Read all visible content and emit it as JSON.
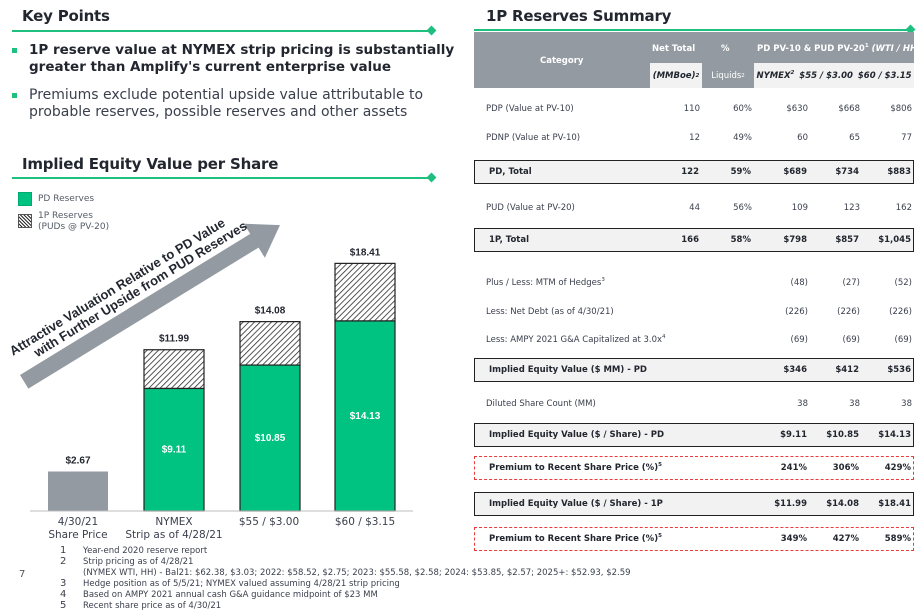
{
  "key_points": {
    "title": "Key Points",
    "bullets": [
      {
        "line1": "1P reserve value at NYMEX strip pricing is substantially",
        "line2": "greater than Amplify's current enterprise value",
        "bold": true
      },
      {
        "line1": "Premiums exclude potential upside value attributable to",
        "line2": "probable reserves, possible reserves and other assets",
        "bold": false
      }
    ]
  },
  "colors": {
    "accent_green": "#1fc07f",
    "pd_green": "#00c281",
    "gray_bar": "#939aa1",
    "header_gray": "#939aa1",
    "dashed_red": "#ee3a3a"
  },
  "chart_title": "Implied Equity Value per Share",
  "arrow_text": {
    "line1": "Attractive Valuation Relative to PD Value",
    "line2": "with Further Upside from PUD Reserves"
  },
  "chart_data": {
    "type": "bar",
    "title": "Implied Equity Value per Share",
    "categories": [
      {
        "line1": "4/30/21",
        "line2": "Share Price"
      },
      {
        "line1": "NYMEX",
        "line2": "Strip as of 4/28/21"
      },
      {
        "line1": "$55 / $3.00",
        "line2": ""
      },
      {
        "line1": "$60 / $3.15",
        "line2": ""
      }
    ],
    "legend": [
      {
        "name": "PD Reserves",
        "style": "solid-green"
      },
      {
        "name": "1P Reserves",
        "sub": "(PUDs @ PV-20)",
        "style": "hatched"
      }
    ],
    "share_price": {
      "value": 2.67,
      "label": "$2.67"
    },
    "series": [
      {
        "name": "PD Reserves",
        "values": [
          null,
          9.11,
          10.85,
          14.13
        ],
        "labels": [
          "",
          "$9.11",
          "$10.85",
          "$14.13"
        ]
      },
      {
        "name": "1P Reserves",
        "values": [
          null,
          11.99,
          14.08,
          18.41
        ],
        "labels": [
          "",
          "$11.99",
          "$14.08",
          "$18.41"
        ]
      }
    ],
    "ylim": [
      0,
      20
    ],
    "xlabel": "",
    "ylabel": "",
    "grid": false
  },
  "footnotes": {
    "page": "7",
    "items": [
      {
        "num": "1",
        "text": "Year-end 2020 reserve report"
      },
      {
        "num": "2",
        "text": "Strip pricing as of 4/28/21"
      },
      {
        "num": "",
        "text": "(NYMEX WTI, HH) - Bal21: $62.38, $3.03; 2022: $58.52, $2.75; 2023: $55.58, $2.58; 2024: $53.85, $2.57; 2025+: $52.93, $2.59"
      },
      {
        "num": "3",
        "text": "Hedge position as of 5/5/21; NYMEX valued assuming 4/28/21 strip pricing"
      },
      {
        "num": "4",
        "text": "Based on AMPY 2021 annual cash G&A guidance midpoint of $23 MM"
      },
      {
        "num": "5",
        "text": "Recent share price as of 4/30/21"
      }
    ]
  },
  "reserves": {
    "title": "1P Reserves Summary",
    "header": {
      "category": "Category",
      "net_total": "Net Total",
      "net_total_unit": "(MMBoe)",
      "net_total_sup": "2",
      "pct": "%",
      "pct_unit": "Liquids",
      "pct_sup": "2",
      "pv_group": "PD PV-10 & PUD PV-20",
      "pv_group_sup": "1",
      "pv_group_italic": " (WTI / HH)",
      "col_nymex": "NYMEX",
      "col_nymex_sup": "2",
      "col_55": "$55 / $3.00",
      "col_60": "$60 / $3.15"
    },
    "rows": [
      {
        "label": "PDP (Value at PV-10)",
        "sup": "",
        "cells": [
          "110",
          "60%",
          "$630",
          "$668",
          "$806"
        ],
        "style": "plain"
      },
      {
        "label": "PDNP (Value at PV-10)",
        "sup": "",
        "cells": [
          "12",
          "49%",
          "60",
          "65",
          "77"
        ],
        "style": "plain"
      },
      {
        "label": "PD, Total",
        "sup": "",
        "cells": [
          "122",
          "59%",
          "$689",
          "$734",
          "$883"
        ],
        "style": "boxed"
      },
      {
        "label": "PUD (Value at PV-20)",
        "sup": "",
        "cells": [
          "44",
          "56%",
          "109",
          "123",
          "162"
        ],
        "style": "plain"
      },
      {
        "label": "1P, Total",
        "sup": "",
        "cells": [
          "166",
          "58%",
          "$798",
          "$857",
          "$1,045"
        ],
        "style": "boxed"
      },
      {
        "label": "Plus / Less: MTM of Hedges",
        "sup": "3",
        "cells": [
          "",
          "",
          "(48)",
          "(27)",
          "(52)"
        ],
        "style": "plain"
      },
      {
        "label": "Less: Net Debt (as of 4/30/21)",
        "sup": "",
        "cells": [
          "",
          "",
          "(226)",
          "(226)",
          "(226)"
        ],
        "style": "plain"
      },
      {
        "label": "Less: AMPY 2021 G&A Capitalized at 3.0x",
        "sup": "4",
        "cells": [
          "",
          "",
          "(69)",
          "(69)",
          "(69)"
        ],
        "style": "plain"
      },
      {
        "label": "Implied Equity Value ($ MM) - PD",
        "sup": "",
        "cells": [
          "",
          "",
          "$346",
          "$412",
          "$536"
        ],
        "style": "boxed"
      },
      {
        "label": "Diluted Share Count (MM)",
        "sup": "",
        "cells": [
          "",
          "",
          "38",
          "38",
          "38"
        ],
        "style": "plain"
      },
      {
        "label": "Implied Equity Value ($ / Share) - PD",
        "sup": "",
        "cells": [
          "",
          "",
          "$9.11",
          "$10.85",
          "$14.13"
        ],
        "style": "boxed"
      },
      {
        "label": "Premium to Recent Share Price (%)",
        "sup": "5",
        "cells": [
          "",
          "",
          "241%",
          "306%",
          "429%"
        ],
        "style": "dashed"
      },
      {
        "label": "Implied Equity Value ($ / Share) - 1P",
        "sup": "",
        "cells": [
          "",
          "",
          "$11.99",
          "$14.08",
          "$18.41"
        ],
        "style": "boxed"
      },
      {
        "label": "Premium to Recent Share Price (%)",
        "sup": "5",
        "cells": [
          "",
          "",
          "349%",
          "427%",
          "589%"
        ],
        "style": "dashed"
      }
    ]
  }
}
